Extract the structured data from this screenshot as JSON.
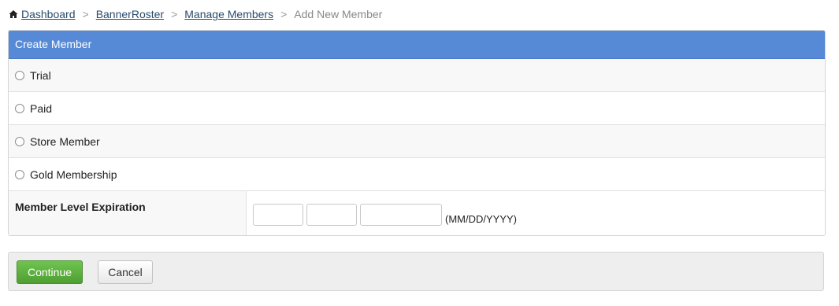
{
  "breadcrumb": {
    "items": [
      "Dashboard",
      "BannerRoster",
      "Manage Members"
    ],
    "current": "Add New Member",
    "separator": ">"
  },
  "panel": {
    "title": "Create Member",
    "options": [
      "Trial",
      "Paid",
      "Store Member",
      "Gold Membership"
    ],
    "expiration_label": "Member Level Expiration",
    "date_hint": "(MM/DD/YYYY)",
    "month_value": "",
    "day_value": "",
    "year_value": ""
  },
  "actions": {
    "continue_label": "Continue",
    "cancel_label": "Cancel"
  },
  "colors": {
    "header": "#5689d6",
    "continue": "#5cae3e"
  }
}
